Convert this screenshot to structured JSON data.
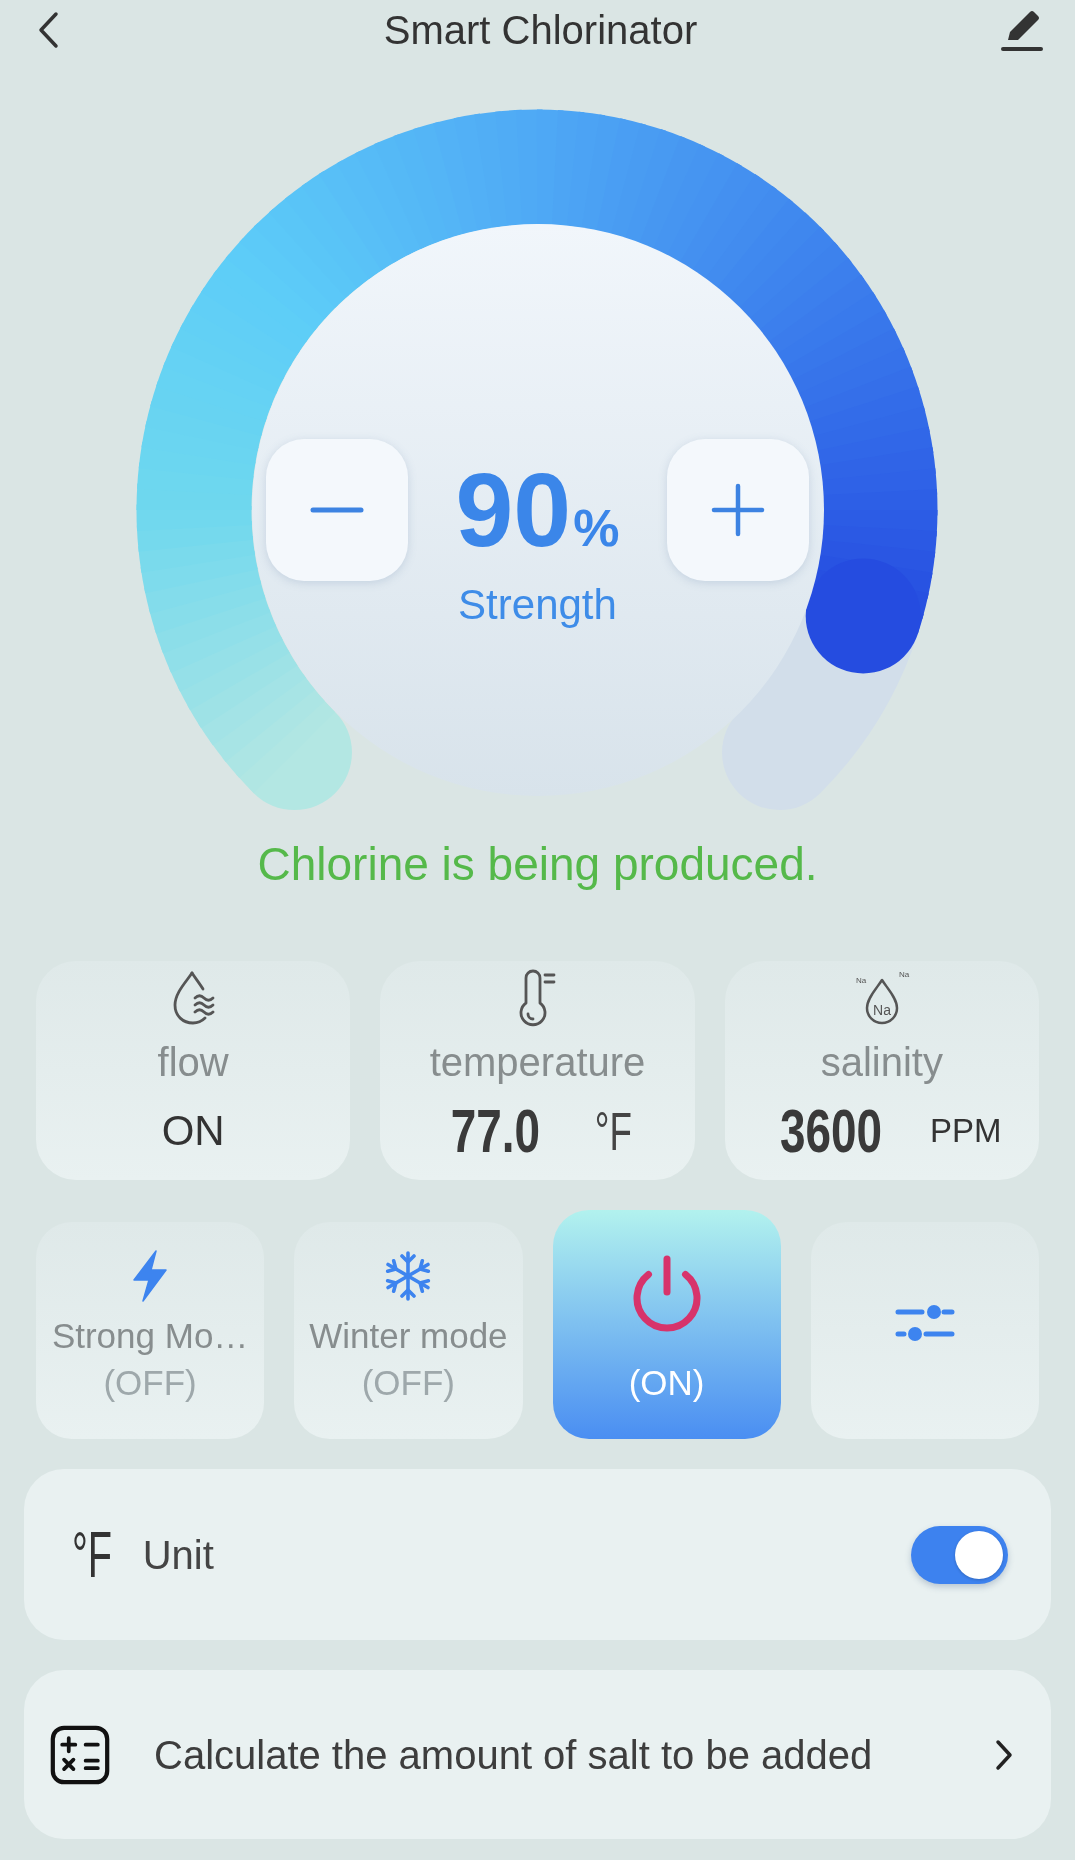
{
  "header": {
    "title": "Smart Chlorinator"
  },
  "gauge": {
    "value": "90",
    "unit": "%",
    "label": "Strength"
  },
  "status_message": "Chlorine is being produced.",
  "metrics": [
    {
      "kind": "flow",
      "label": "flow",
      "value": "ON"
    },
    {
      "kind": "temperature",
      "label": "temperature",
      "value": "77.0",
      "unit": "°F"
    },
    {
      "kind": "salinity",
      "label": "salinity",
      "value": "3600",
      "unit": "PPM",
      "icon_labels": [
        "Na",
        "Na",
        "Na"
      ]
    }
  ],
  "modes": [
    {
      "kind": "strong",
      "label": "Strong Mo…",
      "state": "(OFF)",
      "on": false
    },
    {
      "kind": "winter",
      "label": "Winter mode",
      "state": "(OFF)",
      "on": false
    },
    {
      "kind": "power",
      "state": "(ON)",
      "on": true
    },
    {
      "kind": "settings"
    }
  ],
  "unit_setting": {
    "symbol": "°F",
    "label": "Unit",
    "on": true
  },
  "salt_calculator": {
    "label": "Calculate the amount of salt to be added"
  }
}
